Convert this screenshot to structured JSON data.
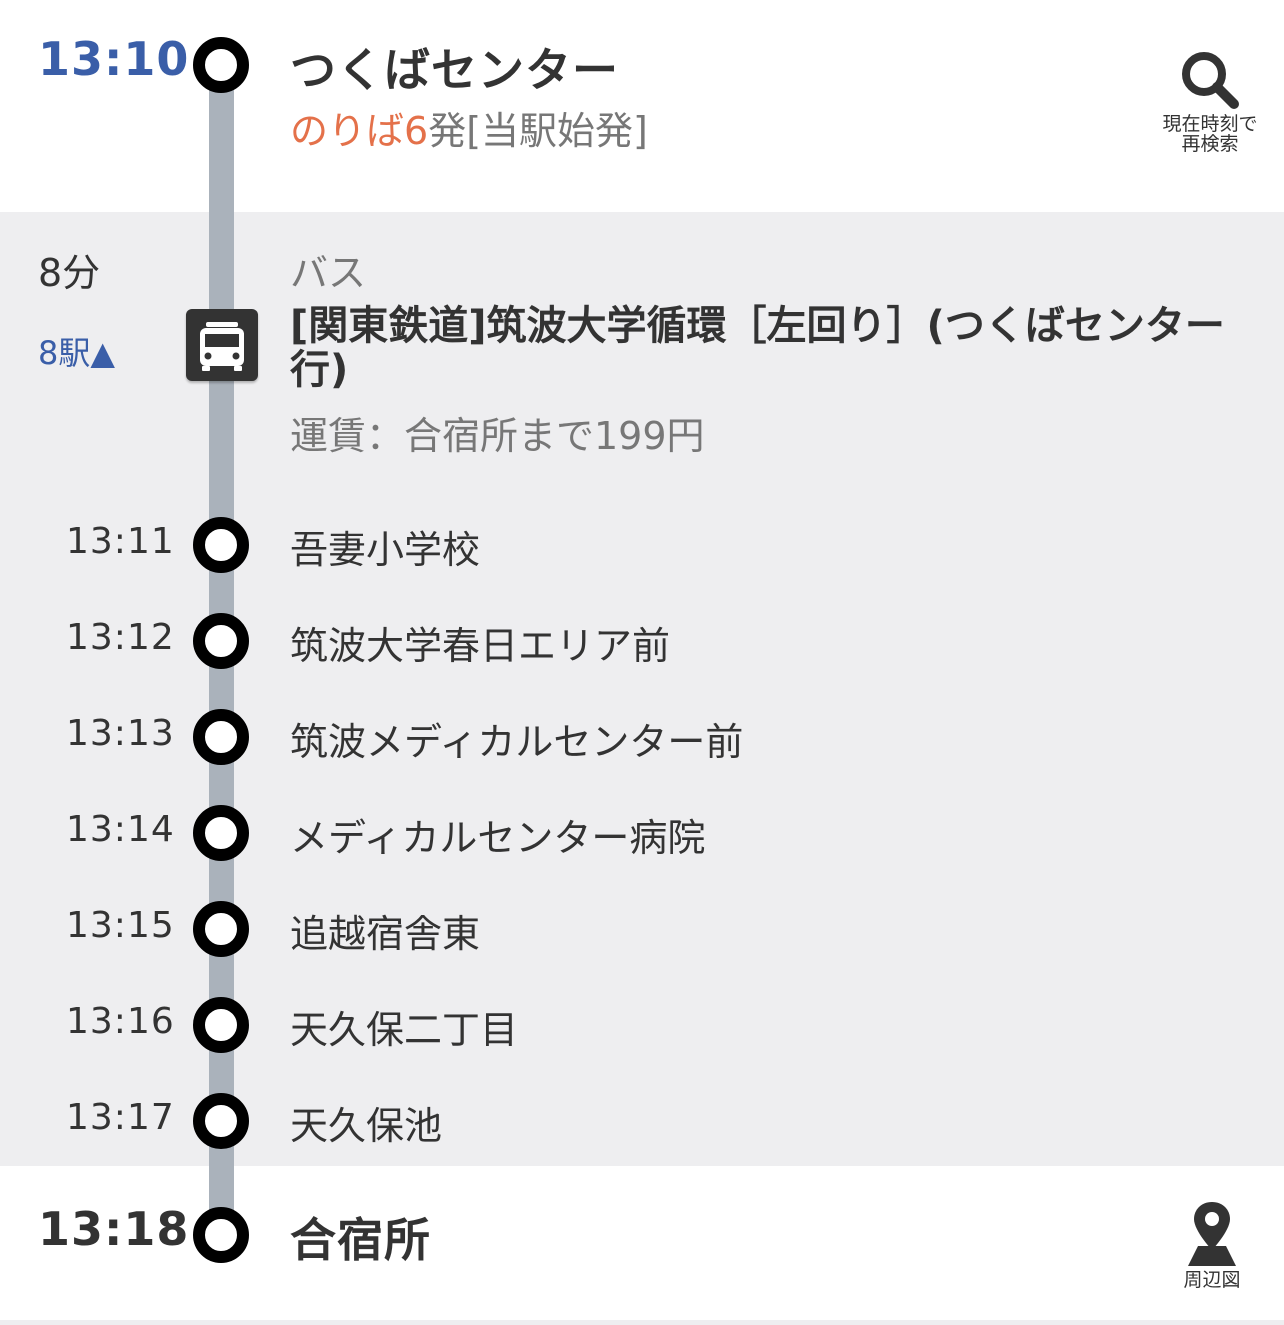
{
  "departure": {
    "time": "13:10",
    "station": "つくばセンター",
    "platform": "のりば6",
    "platform_suffix": "発[当駅始発]"
  },
  "search_now_button": {
    "icon": "search-icon",
    "label_line1": "現在時刻で",
    "label_line2": "再検索"
  },
  "bus_leg": {
    "duration": "8分",
    "stops_toggle": "8駅▲",
    "mode": "バス",
    "icon": "bus-icon",
    "route_name": "[関東鉄道]筑波大学循環［左回り］(つくばセンター行)",
    "fare": "運賃：合宿所まで199円"
  },
  "stops": [
    {
      "time": "13:11",
      "name": "吾妻小学校"
    },
    {
      "time": "13:12",
      "name": "筑波大学春日エリア前"
    },
    {
      "time": "13:13",
      "name": "筑波メディカルセンター前"
    },
    {
      "time": "13:14",
      "name": "メディカルセンター病院"
    },
    {
      "time": "13:15",
      "name": "追越宿舎東"
    },
    {
      "time": "13:16",
      "name": "天久保二丁目"
    },
    {
      "time": "13:17",
      "name": "天久保池"
    }
  ],
  "arrival": {
    "time": "13:18",
    "station": "合宿所"
  },
  "map_button": {
    "icon": "map-pin-icon",
    "label": "周辺図"
  },
  "colors": {
    "accent_blue": "#3a5ea8",
    "platform_orange": "#e4714a",
    "route_line": "#aab2bb",
    "section_bg": "#eeeef0"
  }
}
